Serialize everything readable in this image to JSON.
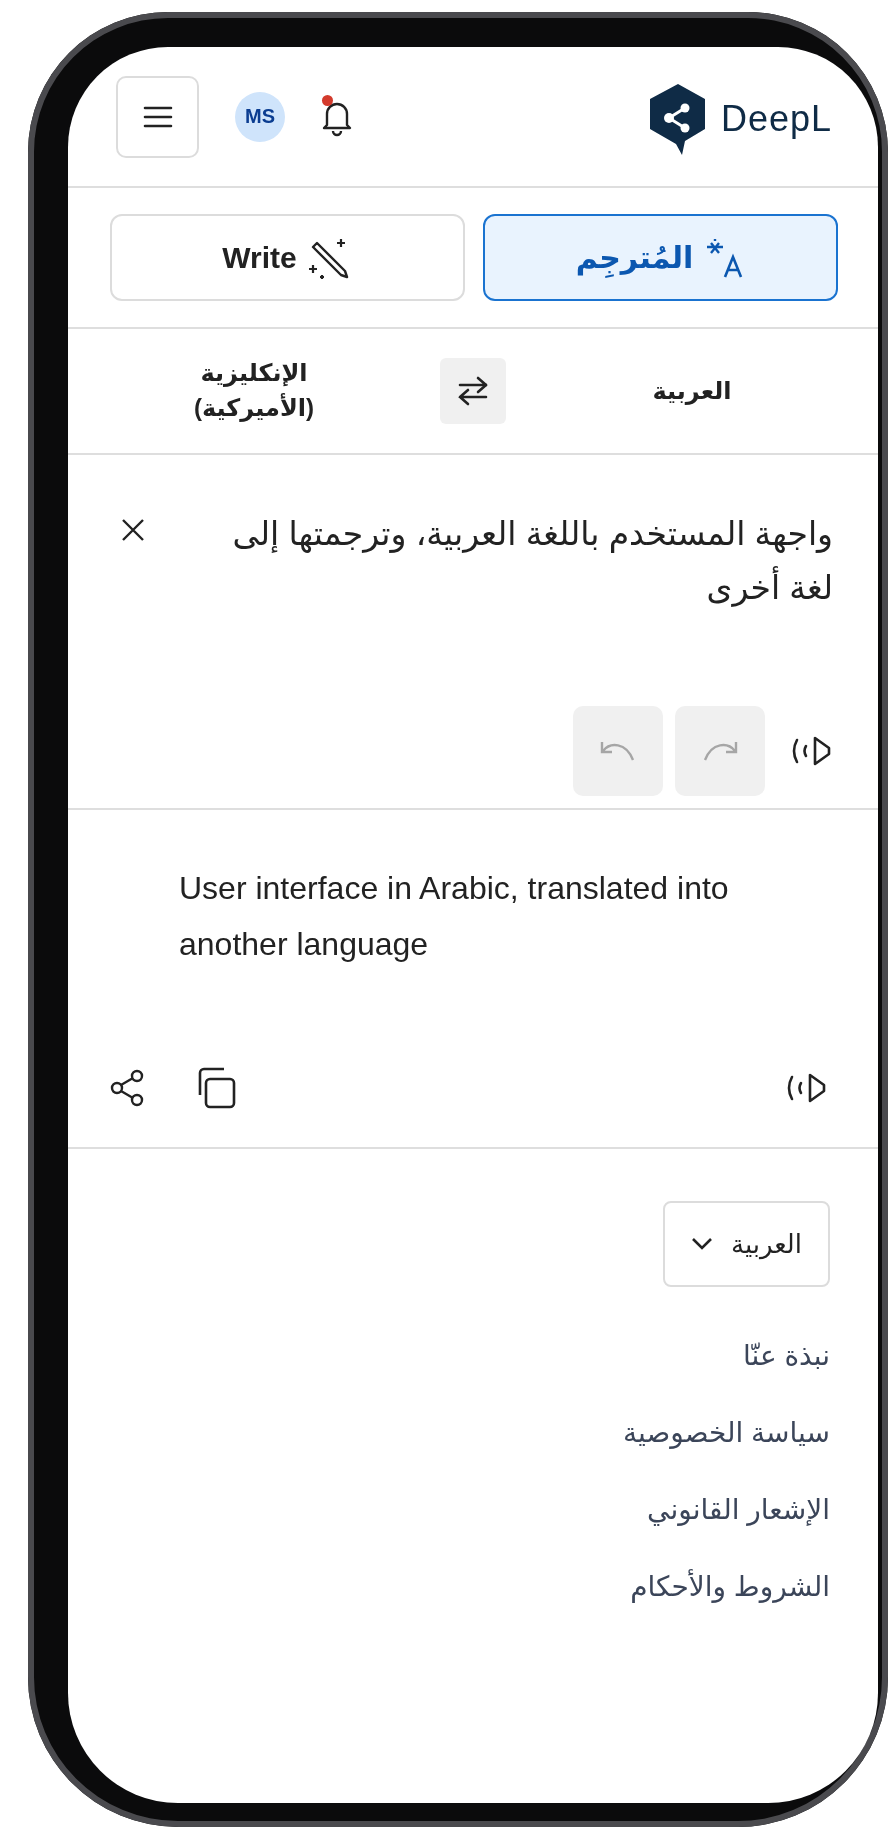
{
  "header": {
    "avatar_initials": "MS",
    "has_unread_notifications": true,
    "logo_text": "DeepL"
  },
  "tabs": [
    {
      "kind": "translate",
      "label": "المُترجِم",
      "selected": true
    },
    {
      "kind": "write",
      "label": "Write",
      "selected": false
    }
  ],
  "languages": {
    "source": "العربية",
    "target": "الإنكليزية (الأميركية)"
  },
  "source_panel": {
    "text": "واجهة المستخدم باللغة العربية، وترجمتها إلى لغة أخرى",
    "undo_disabled": true,
    "redo_disabled": true
  },
  "target_panel": {
    "text": "User interface in Arabic, translated into another language"
  },
  "footer": {
    "language_select": "العربية",
    "links": [
      "نبذة عنّا",
      "سياسة الخصوصية",
      "الإشعار القانوني",
      "الشروط والأحكام"
    ]
  }
}
